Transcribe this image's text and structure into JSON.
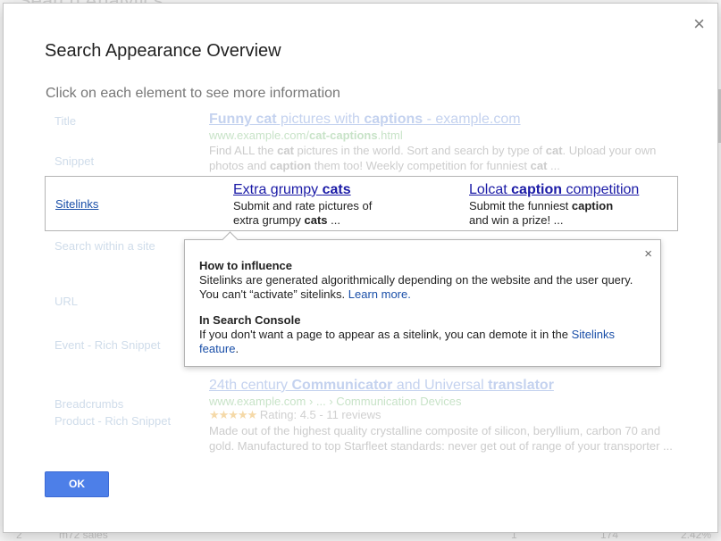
{
  "background": {
    "title": "Search Analytics",
    "bottom_left_num": "2",
    "bottom_sales": "m72 sales",
    "bottom_num1": "1",
    "bottom_num2": "174",
    "bottom_pct": "2.42%"
  },
  "dialog": {
    "title": "Search Appearance Overview",
    "subtitle": "Click on each element to see more information",
    "close_label": "×",
    "ok_label": "OK"
  },
  "labels": {
    "title": "Title",
    "snippet": "Snippet",
    "sitelinks": "Sitelinks",
    "search_within": "Search within a site",
    "url": "URL",
    "event": "Event - Rich Snippet",
    "breadcrumbs": "Breadcrumbs",
    "product": "Product - Rich Snippet"
  },
  "result1": {
    "title_parts": [
      "Funny cat",
      " pictures with ",
      "captions",
      " - example.com"
    ],
    "url_parts": [
      "www.example.com/",
      "cat-captions",
      ".html"
    ],
    "snippet_parts": [
      "Find ALL the ",
      "cat",
      " pictures in the world. Sort and search by type of ",
      "cat",
      ". Upload your own photos and ",
      "caption",
      " them too! Weekly competition for funniest ",
      "cat",
      " ..."
    ]
  },
  "sitelinks": {
    "link1_parts": [
      "Extra grumpy ",
      "cats"
    ],
    "desc1_line1": "Submit and rate pictures of",
    "desc1_line2_parts": [
      "extra grumpy ",
      "cats",
      " ..."
    ],
    "link2_parts": [
      "Lolcat ",
      "caption",
      " competition"
    ],
    "desc2_line1_parts": [
      "Submit the funniest ",
      "caption"
    ],
    "desc2_line2": "and win a prize! ..."
  },
  "popup": {
    "close_label": "×",
    "how_heading": "How to influence",
    "how_line1": "Sitelinks are generated algorithmically depending on the website and the user query.",
    "how_line2": "You can't “activate” sitelinks. ",
    "how_link": "Learn more.",
    "console_heading": "In Search Console",
    "console_text": "If you don't want a page to appear as a sitelink, you can demote it in the ",
    "console_link": "Sitelinks feature",
    "console_end": "."
  },
  "result2": {
    "title_parts": [
      "24th century ",
      "Communicator",
      " and Universal ",
      "translator"
    ],
    "url_text": "www.example.com › ... › Communication Devices",
    "stars": "★★★★★",
    "rating_text": " Rating: 4.5 - 11 reviews",
    "snippet": "Made out of the highest quality crystalline composite of silicon, beryllium, carbon 70 and gold. Manufactured to top Starfleet standards: never get out of range of your transporter ..."
  }
}
